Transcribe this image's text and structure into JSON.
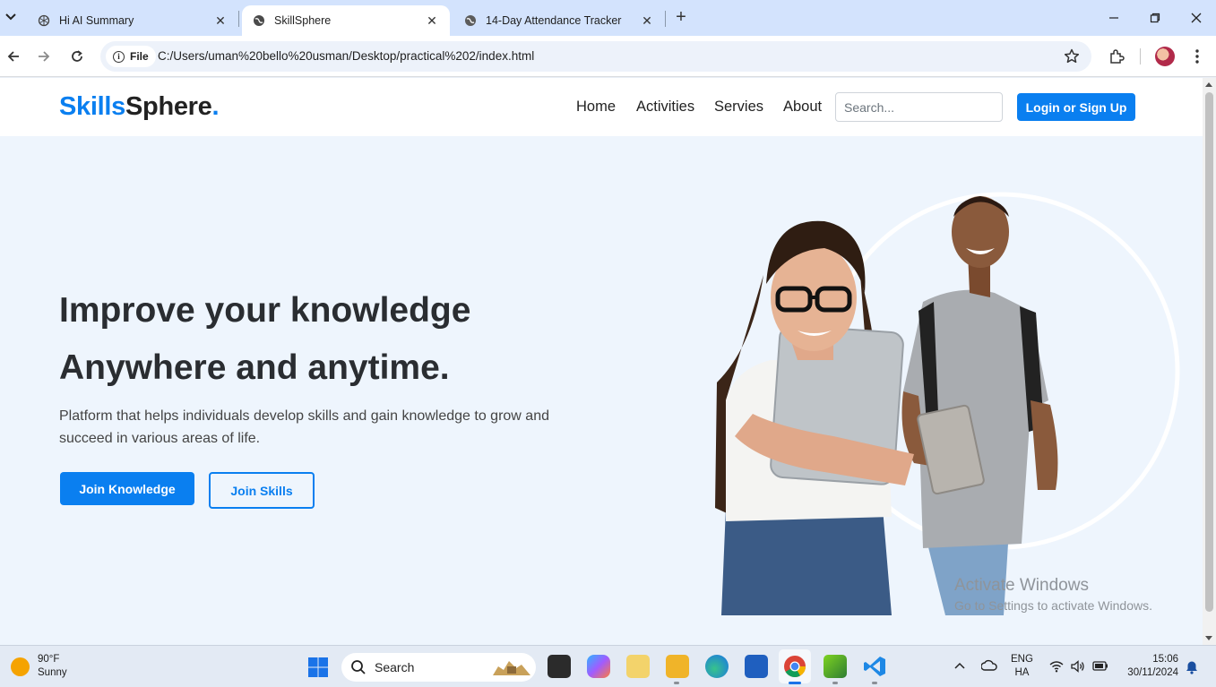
{
  "browser": {
    "tabs": [
      {
        "title": "Hi AI Summary",
        "icon": "openai-icon",
        "active": false
      },
      {
        "title": "SkillSphere",
        "icon": "globe-icon",
        "active": true
      },
      {
        "title": "14-Day Attendance Tracker",
        "icon": "globe-icon",
        "active": false
      }
    ],
    "new_tab": "+",
    "url_scheme_label": "File",
    "url": "C:/Users/uman%20bello%20usman/Desktop/practical%202/index.html"
  },
  "site": {
    "logo": {
      "part1": "Skills",
      "part2": "Sphere",
      "part3": "."
    },
    "nav": [
      "Home",
      "Activities",
      "Servies",
      "About"
    ],
    "search_placeholder": "Search...",
    "login_label": "Login or Sign Up",
    "hero": {
      "title_line1": "Improve your knowledge",
      "title_line2": "Anywhere and anytime.",
      "description": "Platform that helps individuals develop skills and gain knowledge to grow and succeed in various areas of life.",
      "primary_button": "Join Knowledge",
      "secondary_button": "Join Skills"
    },
    "brand_color": "#0a7ff0"
  },
  "watermark": {
    "line1": "Activate Windows",
    "line2": "Go to Settings to activate Windows."
  },
  "taskbar": {
    "weather_temp": "90°F",
    "weather_desc": "Sunny",
    "search_label": "Search",
    "lang_top": "ENG",
    "lang_bottom": "HA",
    "time": "15:06",
    "date": "30/11/2024"
  }
}
